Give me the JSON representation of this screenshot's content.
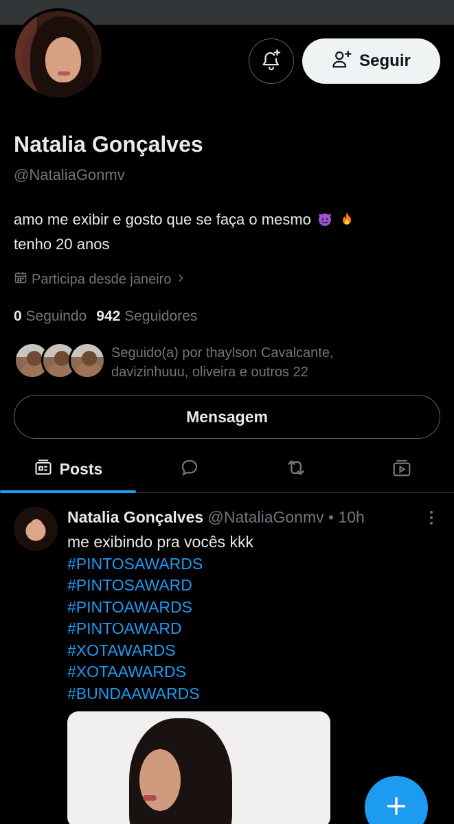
{
  "profile": {
    "name": "Natalia Gonçalves",
    "handle": "@NataliaGonmv",
    "bio_line1": "amo me exibir e gosto que se faça o mesmo",
    "bio_line2": "tenho 20 anos",
    "joined": "Participa desde janeiro",
    "following_count": "0",
    "following_label": "Seguindo",
    "followers_count": "942",
    "followers_label": "Seguidores",
    "followed_by": "Seguido(a) por thaylson Cavalcante, davizinhuuu, oliveira e outros 22"
  },
  "actions": {
    "follow_label": "Seguir",
    "message_label": "Mensagem"
  },
  "tabs": [
    {
      "label": "Posts",
      "icon": "posts-icon",
      "active": true
    },
    {
      "label": "",
      "icon": "reply-icon"
    },
    {
      "label": "",
      "icon": "repost-icon"
    },
    {
      "label": "",
      "icon": "media-icon"
    }
  ],
  "post": {
    "author": "Natalia Gonçalves",
    "handle": "@NataliaGonmv",
    "time": "• 10h",
    "text": "me exibindo pra vocês kkk",
    "hashtags": [
      "#PINTOSAWARDS",
      "#PINTOSAWARD",
      "#PINTOAWARDS",
      "#PINTOAWARD",
      "#XOTAWARDS",
      "#XOTAAWARDS",
      "#BUNDAAWARDS"
    ]
  },
  "colors": {
    "background": "#000000",
    "accent": "#1d9bf0",
    "secondary_text": "#71767b",
    "primary_text": "#e7e9ea"
  }
}
